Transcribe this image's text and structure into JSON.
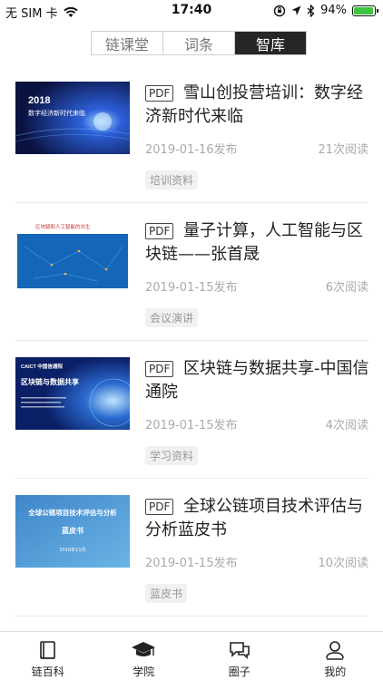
{
  "status_bar": {
    "carrier": "无 SIM 卡",
    "time": "17:40",
    "battery_percent": "94%",
    "battery_level": 0.94,
    "battery_color": "#3fc43f"
  },
  "segment": {
    "tabs": [
      {
        "label": "链课堂",
        "active": false
      },
      {
        "label": "词条",
        "active": false
      },
      {
        "label": "智库",
        "active": true
      }
    ]
  },
  "items": [
    {
      "badge": "PDF",
      "title": "雪山创投营培训：数字经济新时代来临",
      "date": "2019-01-16发布",
      "reads": "21次阅读",
      "tag": "培训资料",
      "thumb": {
        "line1": "2018",
        "line2": "数字经济新时代来临"
      }
    },
    {
      "badge": "PDF",
      "title": "量子计算，人工智能与区块链——张首晟",
      "date": "2019-01-15发布",
      "reads": "6次阅读",
      "tag": "会议演讲",
      "thumb": {
        "line1": "区块链和人工智能的共生"
      }
    },
    {
      "badge": "PDF",
      "title": "区块链与数据共享-中国信通院",
      "date": "2019-01-15发布",
      "reads": "4次阅读",
      "tag": "学习资料",
      "thumb": {
        "line1": "CAICT 中国信通院",
        "line2": "区块链与数据共享"
      }
    },
    {
      "badge": "PDF",
      "title": "全球公链项目技术评估与分析蓝皮书",
      "date": "2019-01-15发布",
      "reads": "10次阅读",
      "tag": "蓝皮书",
      "thumb": {
        "line1": "全球公链项目技术评估与分析",
        "line2": "蓝皮书",
        "line3": "2018年11月"
      }
    }
  ],
  "tabbar": [
    {
      "label": "链百科",
      "icon": "book-icon"
    },
    {
      "label": "学院",
      "icon": "graduation-cap-icon"
    },
    {
      "label": "圈子",
      "icon": "chat-bubbles-icon"
    },
    {
      "label": "我的",
      "icon": "user-icon"
    }
  ]
}
